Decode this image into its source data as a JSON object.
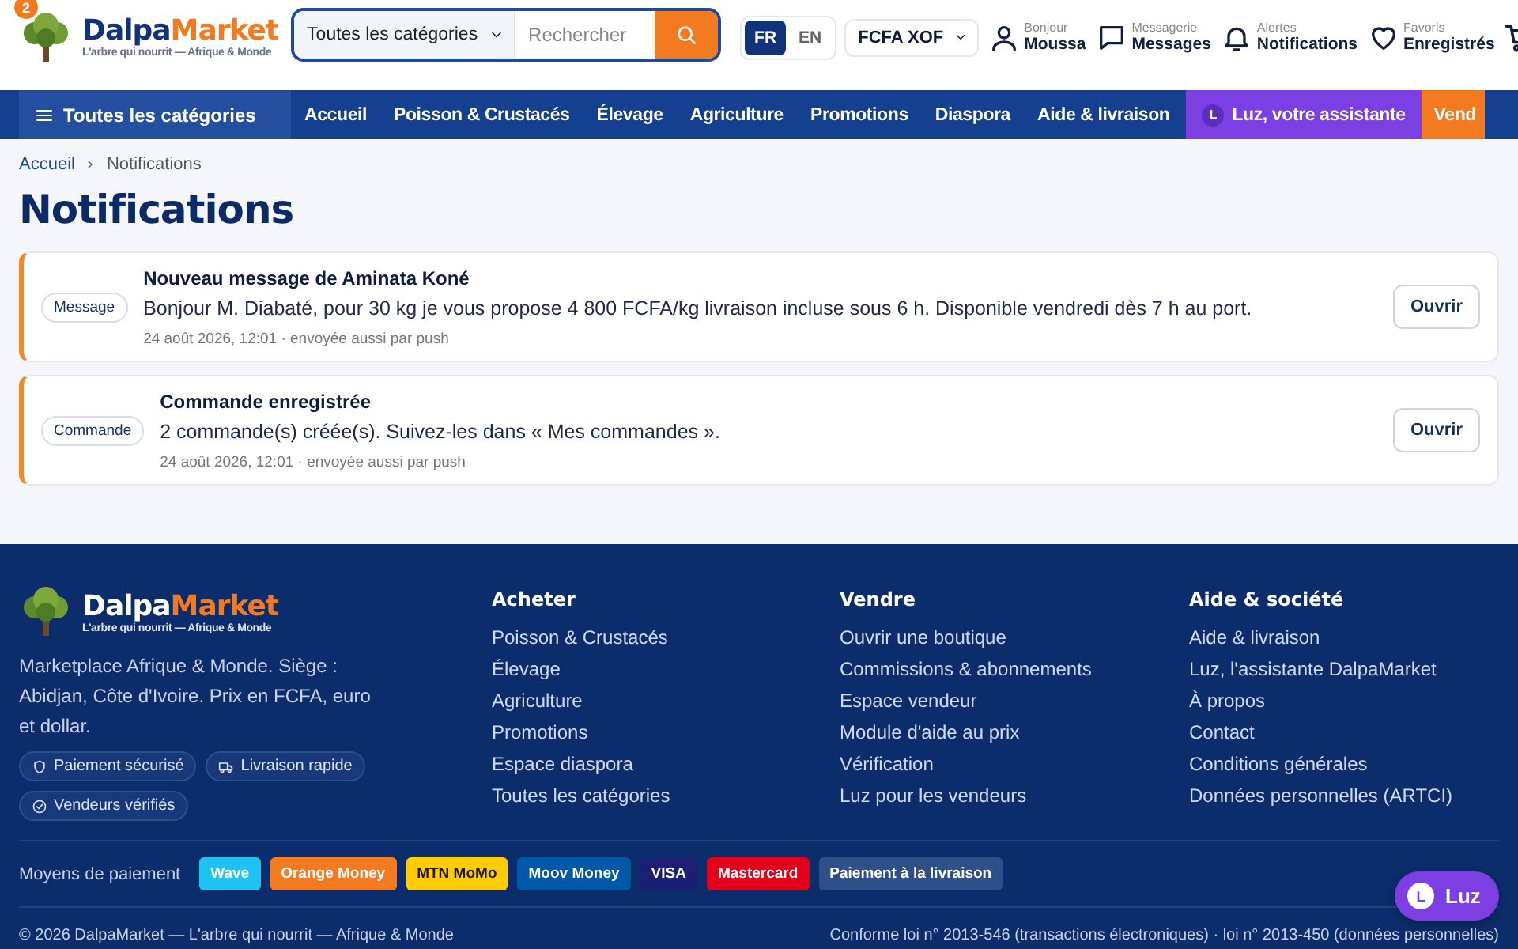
{
  "header": {
    "badge": "2",
    "logo": {
      "name_a": "Dalpa",
      "name_b": "Market",
      "tagline": "L'arbre qui nourrit — Afrique & Monde"
    },
    "search": {
      "category": "Toutes les catégories",
      "placeholder": "Rechercher"
    },
    "languages": [
      {
        "label": "FR",
        "selected": true
      },
      {
        "label": "EN",
        "selected": false
      }
    ],
    "currency": "FCFA XOF",
    "account": [
      {
        "kind": "user",
        "caption": "Bonjour",
        "label": "Moussa"
      },
      {
        "kind": "message",
        "caption": "Messagerie",
        "label": "Messages"
      },
      {
        "kind": "bell",
        "caption": "Alertes",
        "label": "Notifications"
      },
      {
        "kind": "heart",
        "caption": "Favoris",
        "label": "Enregistrés"
      }
    ],
    "cart": true
  },
  "nav": {
    "all_categories": "Toutes les catégories",
    "items": [
      {
        "kind": "link",
        "label": "Accueil"
      },
      {
        "kind": "link",
        "label": "Poisson & Crustacés"
      },
      {
        "kind": "link",
        "label": "Élevage"
      },
      {
        "kind": "link",
        "label": "Agriculture"
      },
      {
        "kind": "link",
        "label": "Promotions"
      },
      {
        "kind": "link",
        "label": "Diaspora"
      },
      {
        "kind": "link",
        "label": "Aide & livraison"
      },
      {
        "kind": "assistant",
        "label": "Luz, votre assistante",
        "letter": "L"
      },
      {
        "kind": "sell",
        "label": "Vend"
      }
    ]
  },
  "breadcrumb": [
    "Accueil",
    "Notifications"
  ],
  "title": "Notifications",
  "notifications": [
    {
      "tag": "Message",
      "title": "Nouveau message de Aminata Koné",
      "body": "Bonjour M. Diabaté, pour 30 kg je vous propose 4 800 FCFA/kg livraison incluse sous 6 h. Disponible vendredi dès 7 h au port.",
      "meta": "24 août 2026, 12:01 · envoyée aussi par push",
      "action": "Ouvrir"
    },
    {
      "tag": "Commande",
      "title": "Commande enregistrée",
      "body": "2 commande(s) créée(s). Suivez-les dans « Mes commandes ».",
      "meta": "24 août 2026, 12:01 · envoyée aussi par push",
      "action": "Ouvrir"
    }
  ],
  "footer": {
    "logo": {
      "name_a": "Dalpa",
      "name_b": "Market",
      "tagline": "L'arbre qui nourrit — Afrique & Monde"
    },
    "description": "Marketplace Afrique & Monde. Siège : Abidjan, Côte d'Ivoire. Prix en FCFA, euro et dollar.",
    "badges": [
      {
        "kind": "shield",
        "label": "Paiement sécurisé"
      },
      {
        "kind": "truck",
        "label": "Livraison rapide"
      },
      {
        "kind": "check",
        "label": "Vendeurs vérifiés"
      }
    ],
    "columns": [
      {
        "title": "Acheter",
        "links": [
          "Poisson & Crustacés",
          "Élevage",
          "Agriculture",
          "Promotions",
          "Espace diaspora",
          "Toutes les catégories"
        ]
      },
      {
        "title": "Vendre",
        "links": [
          "Ouvrir une boutique",
          "Commissions & abonnements",
          "Espace vendeur",
          "Module d'aide au prix",
          "Vérification",
          "Luz pour les vendeurs"
        ]
      },
      {
        "title": "Aide & société",
        "links": [
          "Aide & livraison",
          "Luz, l'assistante DalpaMarket",
          "À propos",
          "Contact",
          "Conditions générales",
          "Données personnelles (ARTCI)"
        ]
      }
    ],
    "payment_label": "Moyens de paiement",
    "payments": [
      {
        "label": "Wave",
        "color": "#1fc3f3"
      },
      {
        "label": "Orange Money",
        "color": "#f47a20"
      },
      {
        "label": "MTN MoMo",
        "color": "#ffcc00"
      },
      {
        "label": "Moov Money",
        "color": "#0058a8"
      },
      {
        "label": "VISA",
        "color": "#1a1f71"
      },
      {
        "label": "Mastercard",
        "color": "#e3001b"
      },
      {
        "label": "Paiement à la livraison",
        "color": "#2e4f88"
      }
    ],
    "copyright": "© 2026 DalpaMarket — L'arbre qui nourrit — Afrique & Monde",
    "legal": "Conforme loi n° 2013-546 (transactions électroniques) · loi n° 2013-450 (données personnelles)"
  },
  "chat_button": {
    "letter": "L",
    "label": "Luz"
  }
}
